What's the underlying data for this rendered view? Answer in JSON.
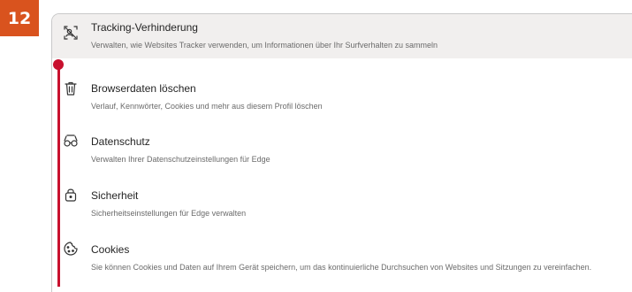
{
  "step_badge": "12",
  "settings_list": [
    {
      "icon": "tracking-icon",
      "title": "Tracking-Verhinderung",
      "description": "Verwalten, wie Websites Tracker verwenden, um Informationen über Ihr Surfverhalten zu sammeln",
      "selected": true
    },
    {
      "icon": "trash-icon",
      "title": "Browserdaten löschen",
      "description": "Verlauf, Kennwörter, Cookies und mehr aus diesem Profil löschen",
      "selected": false
    },
    {
      "icon": "glasses-icon",
      "title": "Datenschutz",
      "description": "Verwalten Ihrer Datenschutzeinstellungen für Edge",
      "selected": false
    },
    {
      "icon": "lock-icon",
      "title": "Sicherheit",
      "description": "Sicherheitseinstellungen für Edge verwalten",
      "selected": false
    },
    {
      "icon": "cookie-icon",
      "title": "Cookies",
      "description": "Sie können Cookies und Daten auf Ihrem Gerät speichern, um das kontinuierliche Durchsuchen von Websites und Sitzungen zu vereinfachen.",
      "selected": false
    }
  ],
  "colors": {
    "badge": "#d9531e",
    "callout": "#c8102e",
    "selected_row": "#f1efee"
  }
}
